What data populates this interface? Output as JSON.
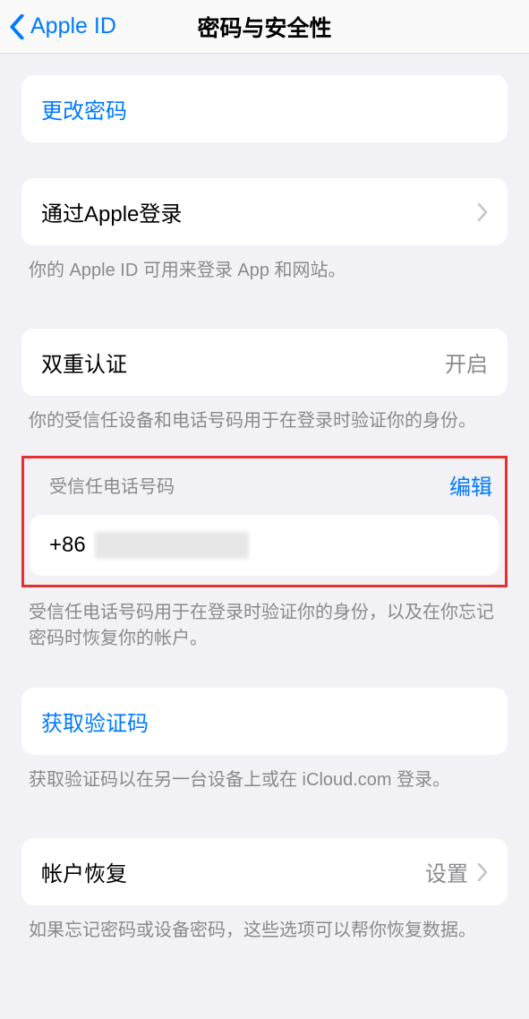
{
  "nav": {
    "back_label": "Apple ID",
    "title": "密码与安全性"
  },
  "change_password": {
    "label": "更改密码"
  },
  "sign_in_with_apple": {
    "label": "通过Apple登录",
    "footer": "你的 Apple ID 可用来登录 App 和网站。"
  },
  "two_factor": {
    "label": "双重认证",
    "value": "开启",
    "footer": "你的受信任设备和电话号码用于在登录时验证你的身份。"
  },
  "trusted_phone": {
    "header": "受信任电话号码",
    "edit_label": "编辑",
    "prefix": "+86",
    "footer": "受信任电话号码用于在登录时验证你的身份，以及在你忘记密码时恢复你的帐户。"
  },
  "get_code": {
    "label": "获取验证码",
    "footer": "获取验证码以在另一台设备上或在 iCloud.com 登录。"
  },
  "account_recovery": {
    "label": "帐户恢复",
    "value": "设置",
    "footer": "如果忘记密码或设备密码，这些选项可以帮你恢复数据。"
  }
}
